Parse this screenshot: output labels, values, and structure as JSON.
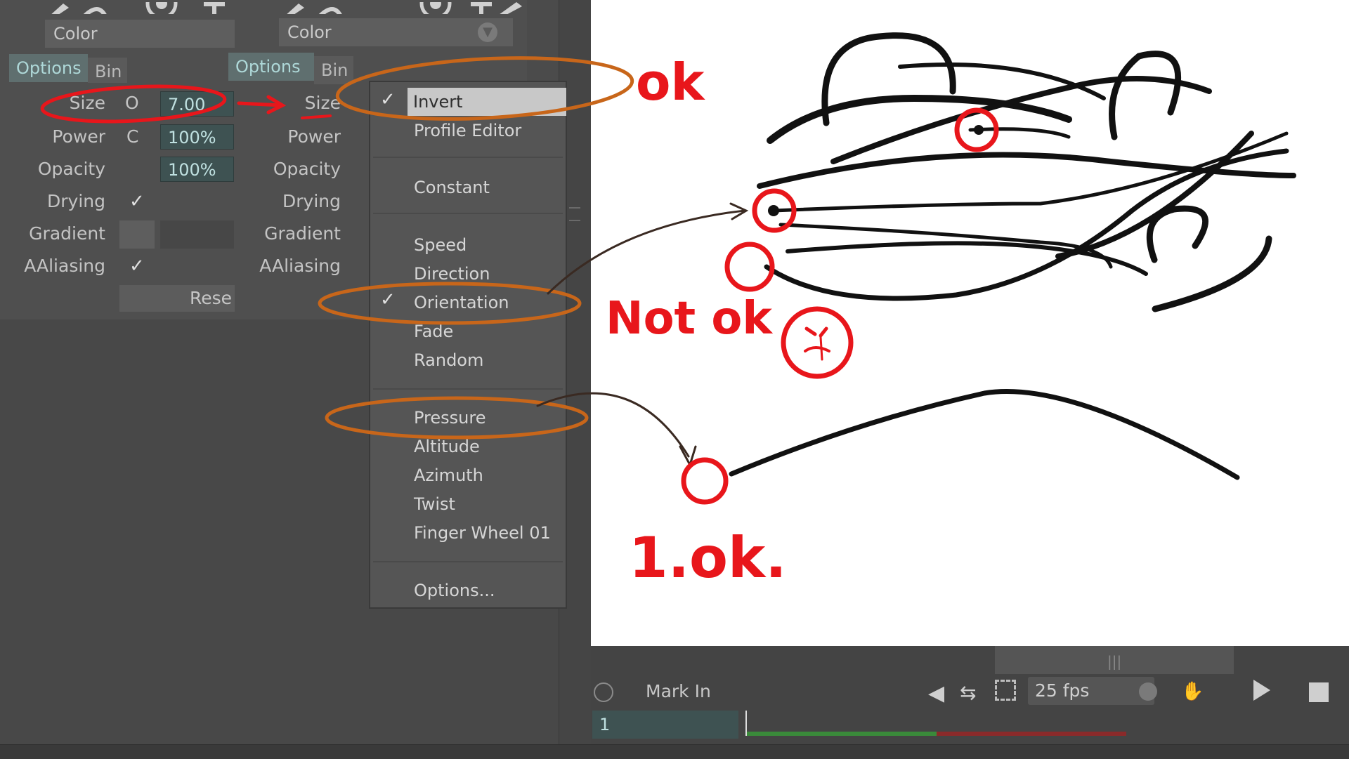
{
  "panel_left": {
    "color_label": "Color",
    "tabs": [
      {
        "label": "Options",
        "active": true
      },
      {
        "label": "Bin",
        "active": false
      }
    ],
    "rows": [
      {
        "label": "Size",
        "field": "7.00",
        "mini": "O"
      },
      {
        "label": "Power",
        "field": "100%",
        "mini": "C"
      },
      {
        "label": "Opacity",
        "field": "100%"
      },
      {
        "label": "Drying",
        "check": "✓"
      },
      {
        "label": "Gradient"
      },
      {
        "label": "AAliasing",
        "check": "✓"
      }
    ],
    "reset_label": "Rese"
  },
  "panel_right": {
    "color_label": "Color",
    "tabs": [
      {
        "label": "Options",
        "active": true
      },
      {
        "label": "Bin",
        "active": false
      }
    ],
    "rows": [
      "Size",
      "Power",
      "Opacity",
      "Drying",
      "Gradient",
      "AAliasing"
    ]
  },
  "menu": {
    "items": [
      {
        "label": "Invert",
        "checked": true,
        "highlighted": true
      },
      {
        "label": "Profile Editor"
      },
      {
        "label": "Constant"
      },
      {
        "label": "Speed"
      },
      {
        "label": "Direction"
      },
      {
        "label": "Orientation",
        "checked": true
      },
      {
        "label": "Fade"
      },
      {
        "label": "Random"
      },
      {
        "label": "Pressure"
      },
      {
        "label": "Altitude"
      },
      {
        "label": "Azimuth"
      },
      {
        "label": "Twist"
      },
      {
        "label": "Finger Wheel 01"
      },
      {
        "label": "Options..."
      }
    ],
    "check_glyph": "✓"
  },
  "timeline": {
    "mark_in_label": "Mark In",
    "fps_value": "25 fps",
    "frame_value": "1"
  },
  "annotations": {
    "ok_label": "ok",
    "not_ok_label": "Not ok",
    "one_ok_label": "1.ok."
  },
  "colors": {
    "annotation_red": "#e8161b",
    "annotation_orange": "#c8661a",
    "panel_bg": "#4f4f4f",
    "field_bg": "#3e5252",
    "canvas_bg": "#ffffff"
  }
}
